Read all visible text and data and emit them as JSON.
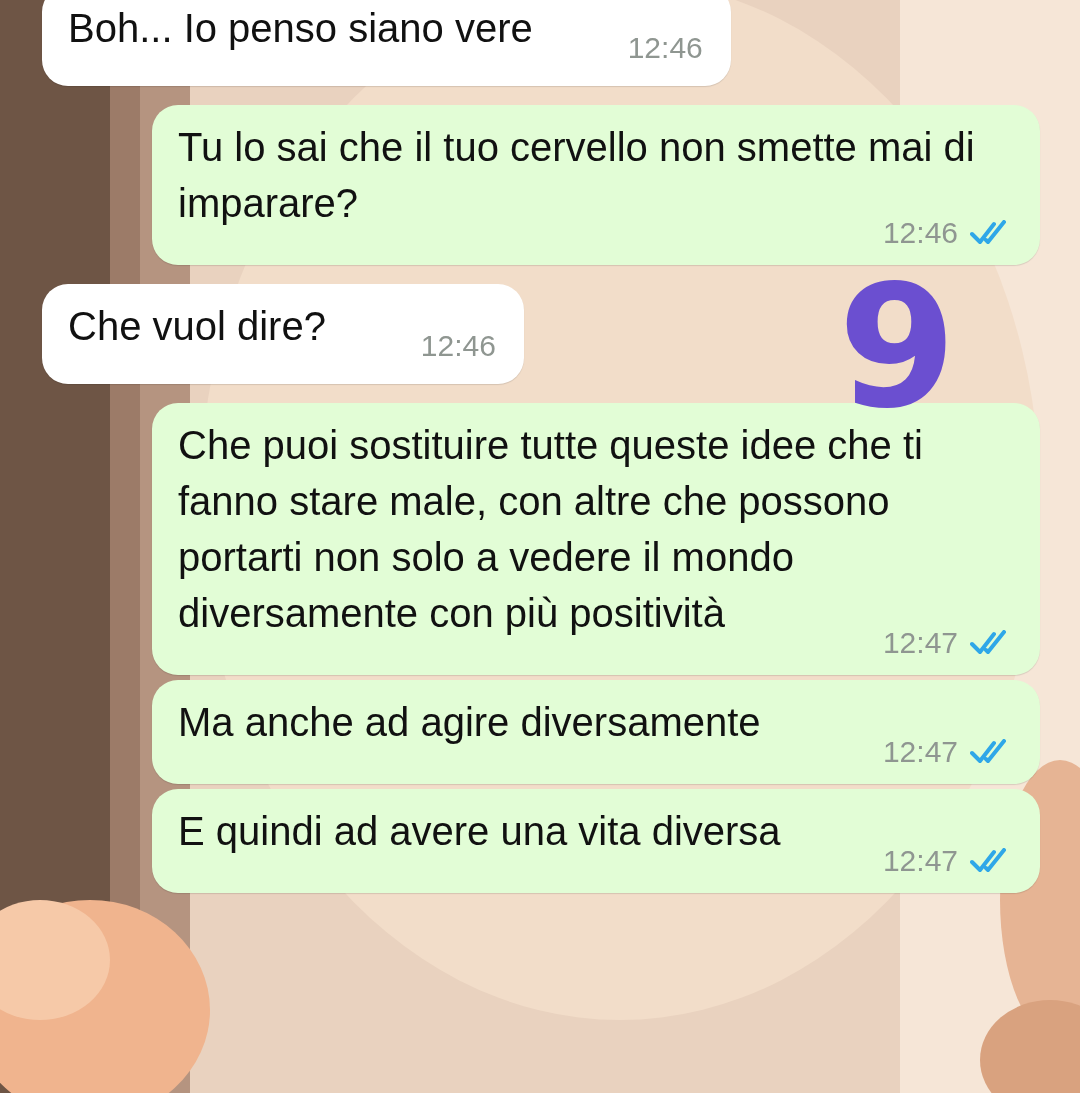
{
  "messages": [
    {
      "kind": "incoming",
      "text": "Boh... Io penso siano vere",
      "time": "12:46"
    },
    {
      "kind": "outgoing",
      "text": "Tu lo sai che il tuo cervello non smette mai di imparare?",
      "time": "12:46",
      "read": true
    },
    {
      "kind": "incoming",
      "text": "Che vuol dire?",
      "time": "12:46"
    },
    {
      "kind": "outgoing",
      "text": "Che puoi sostituire tutte queste idee che ti fanno stare male, con altre che possono portarti non solo a vedere il mondo diversamente con più positività",
      "time": "12:47",
      "read": true
    },
    {
      "kind": "outgoing",
      "text": "Ma anche ad agire diversamente",
      "time": "12:47",
      "read": true
    },
    {
      "kind": "outgoing",
      "text": "E quindi ad avere una vita diversa",
      "time": "12:47",
      "read": true
    }
  ],
  "annotation": {
    "text": "9"
  }
}
